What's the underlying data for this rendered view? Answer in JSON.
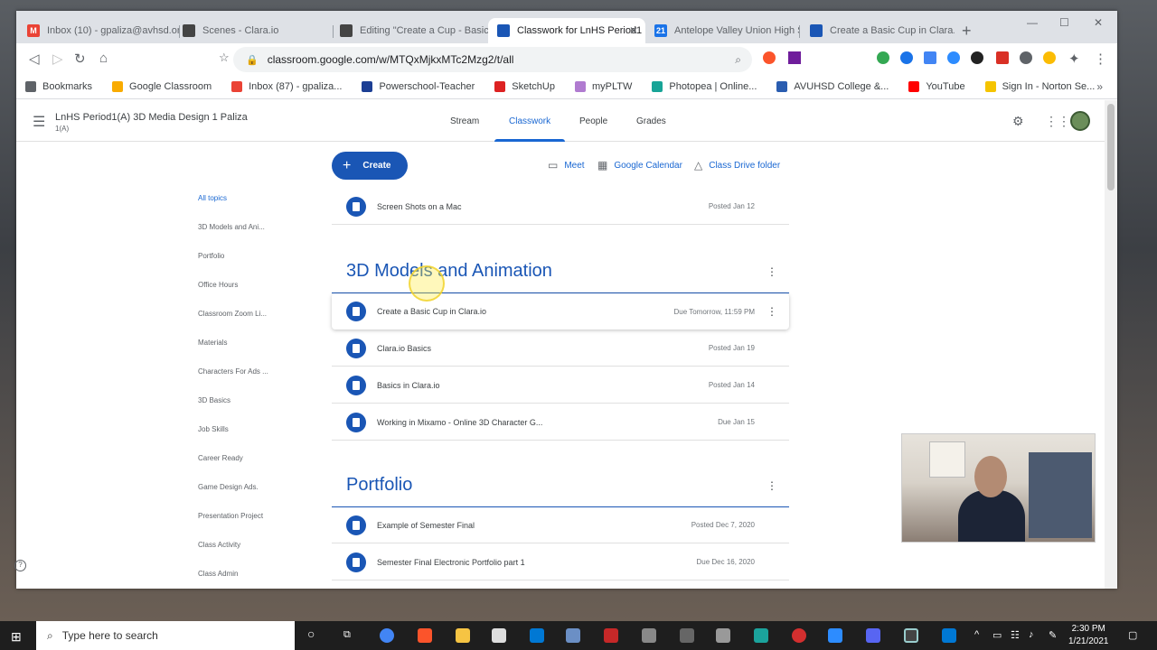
{
  "browser": {
    "tabs": [
      {
        "label": "Inbox (10) - gpaliza@avhsd.org",
        "active": false
      },
      {
        "label": "Scenes - Clara.io",
        "active": false
      },
      {
        "label": "Editing \"Create a Cup - Basics\"",
        "active": false
      },
      {
        "label": "Classwork for LnHS Period1",
        "active": true
      },
      {
        "label": "Antelope Valley Union High Sch",
        "active": false
      },
      {
        "label": "Create a Basic Cup in Clara.io",
        "active": false
      }
    ],
    "url": "classroom.google.com/w/MTQxMjkxMTc2Mzg2/t/all",
    "bookmarks": [
      "Bookmarks",
      "Google Classroom",
      "Inbox (87) - gpaliza...",
      "Powerschool-Teacher",
      "SketchUp",
      "myPLTW",
      "Photopea | Online...",
      "AVUHSD College &...",
      "YouTube",
      "Sign In - Norton Se..."
    ],
    "more": "»"
  },
  "classroom": {
    "class_title": "LnHS Period1(A) 3D Media Design 1 Paliza",
    "class_section": "1(A)",
    "tabs": [
      "Stream",
      "Classwork",
      "People",
      "Grades"
    ],
    "create_label": "Create",
    "links": [
      "Meet",
      "Google Calendar",
      "Class Drive folder"
    ],
    "topics": [
      "All topics",
      "3D Models and Ani...",
      "Portfolio",
      "Office Hours",
      "Classroom Zoom Li...",
      "Materials",
      "Characters For Ads ...",
      "3D Basics",
      "Job Skills",
      "Career Ready",
      "Game Design Ads.",
      "Presentation Project",
      "Class Activity",
      "Class Admin"
    ],
    "top_item": {
      "name": "Screen Shots on a Mac",
      "meta": "Posted Jan 12"
    },
    "sections": [
      {
        "title": "3D Models and Animation",
        "items": [
          {
            "name": "Create a Basic Cup in Clara.io",
            "meta": "Due Tomorrow, 11:59 PM"
          },
          {
            "name": "Clara.io Basics",
            "meta": "Posted Jan 19"
          },
          {
            "name": "Basics in Clara.io",
            "meta": "Posted Jan 14"
          },
          {
            "name": "Working in Mixamo - Online 3D Character G...",
            "meta": "Due Jan 15"
          }
        ]
      },
      {
        "title": "Portfolio",
        "items": [
          {
            "name": "Example of Semester Final",
            "meta": "Posted Dec 7, 2020"
          },
          {
            "name": "Semester Final Electronic Portfolio part 1",
            "meta": "Due Dec 16, 2020"
          }
        ]
      }
    ]
  },
  "taskbar": {
    "search_placeholder": "Type here to search",
    "time": "2:30 PM",
    "date": "1/21/2021"
  },
  "colors": {
    "accent": "#1967d2",
    "primary_button": "#1a56b5"
  }
}
